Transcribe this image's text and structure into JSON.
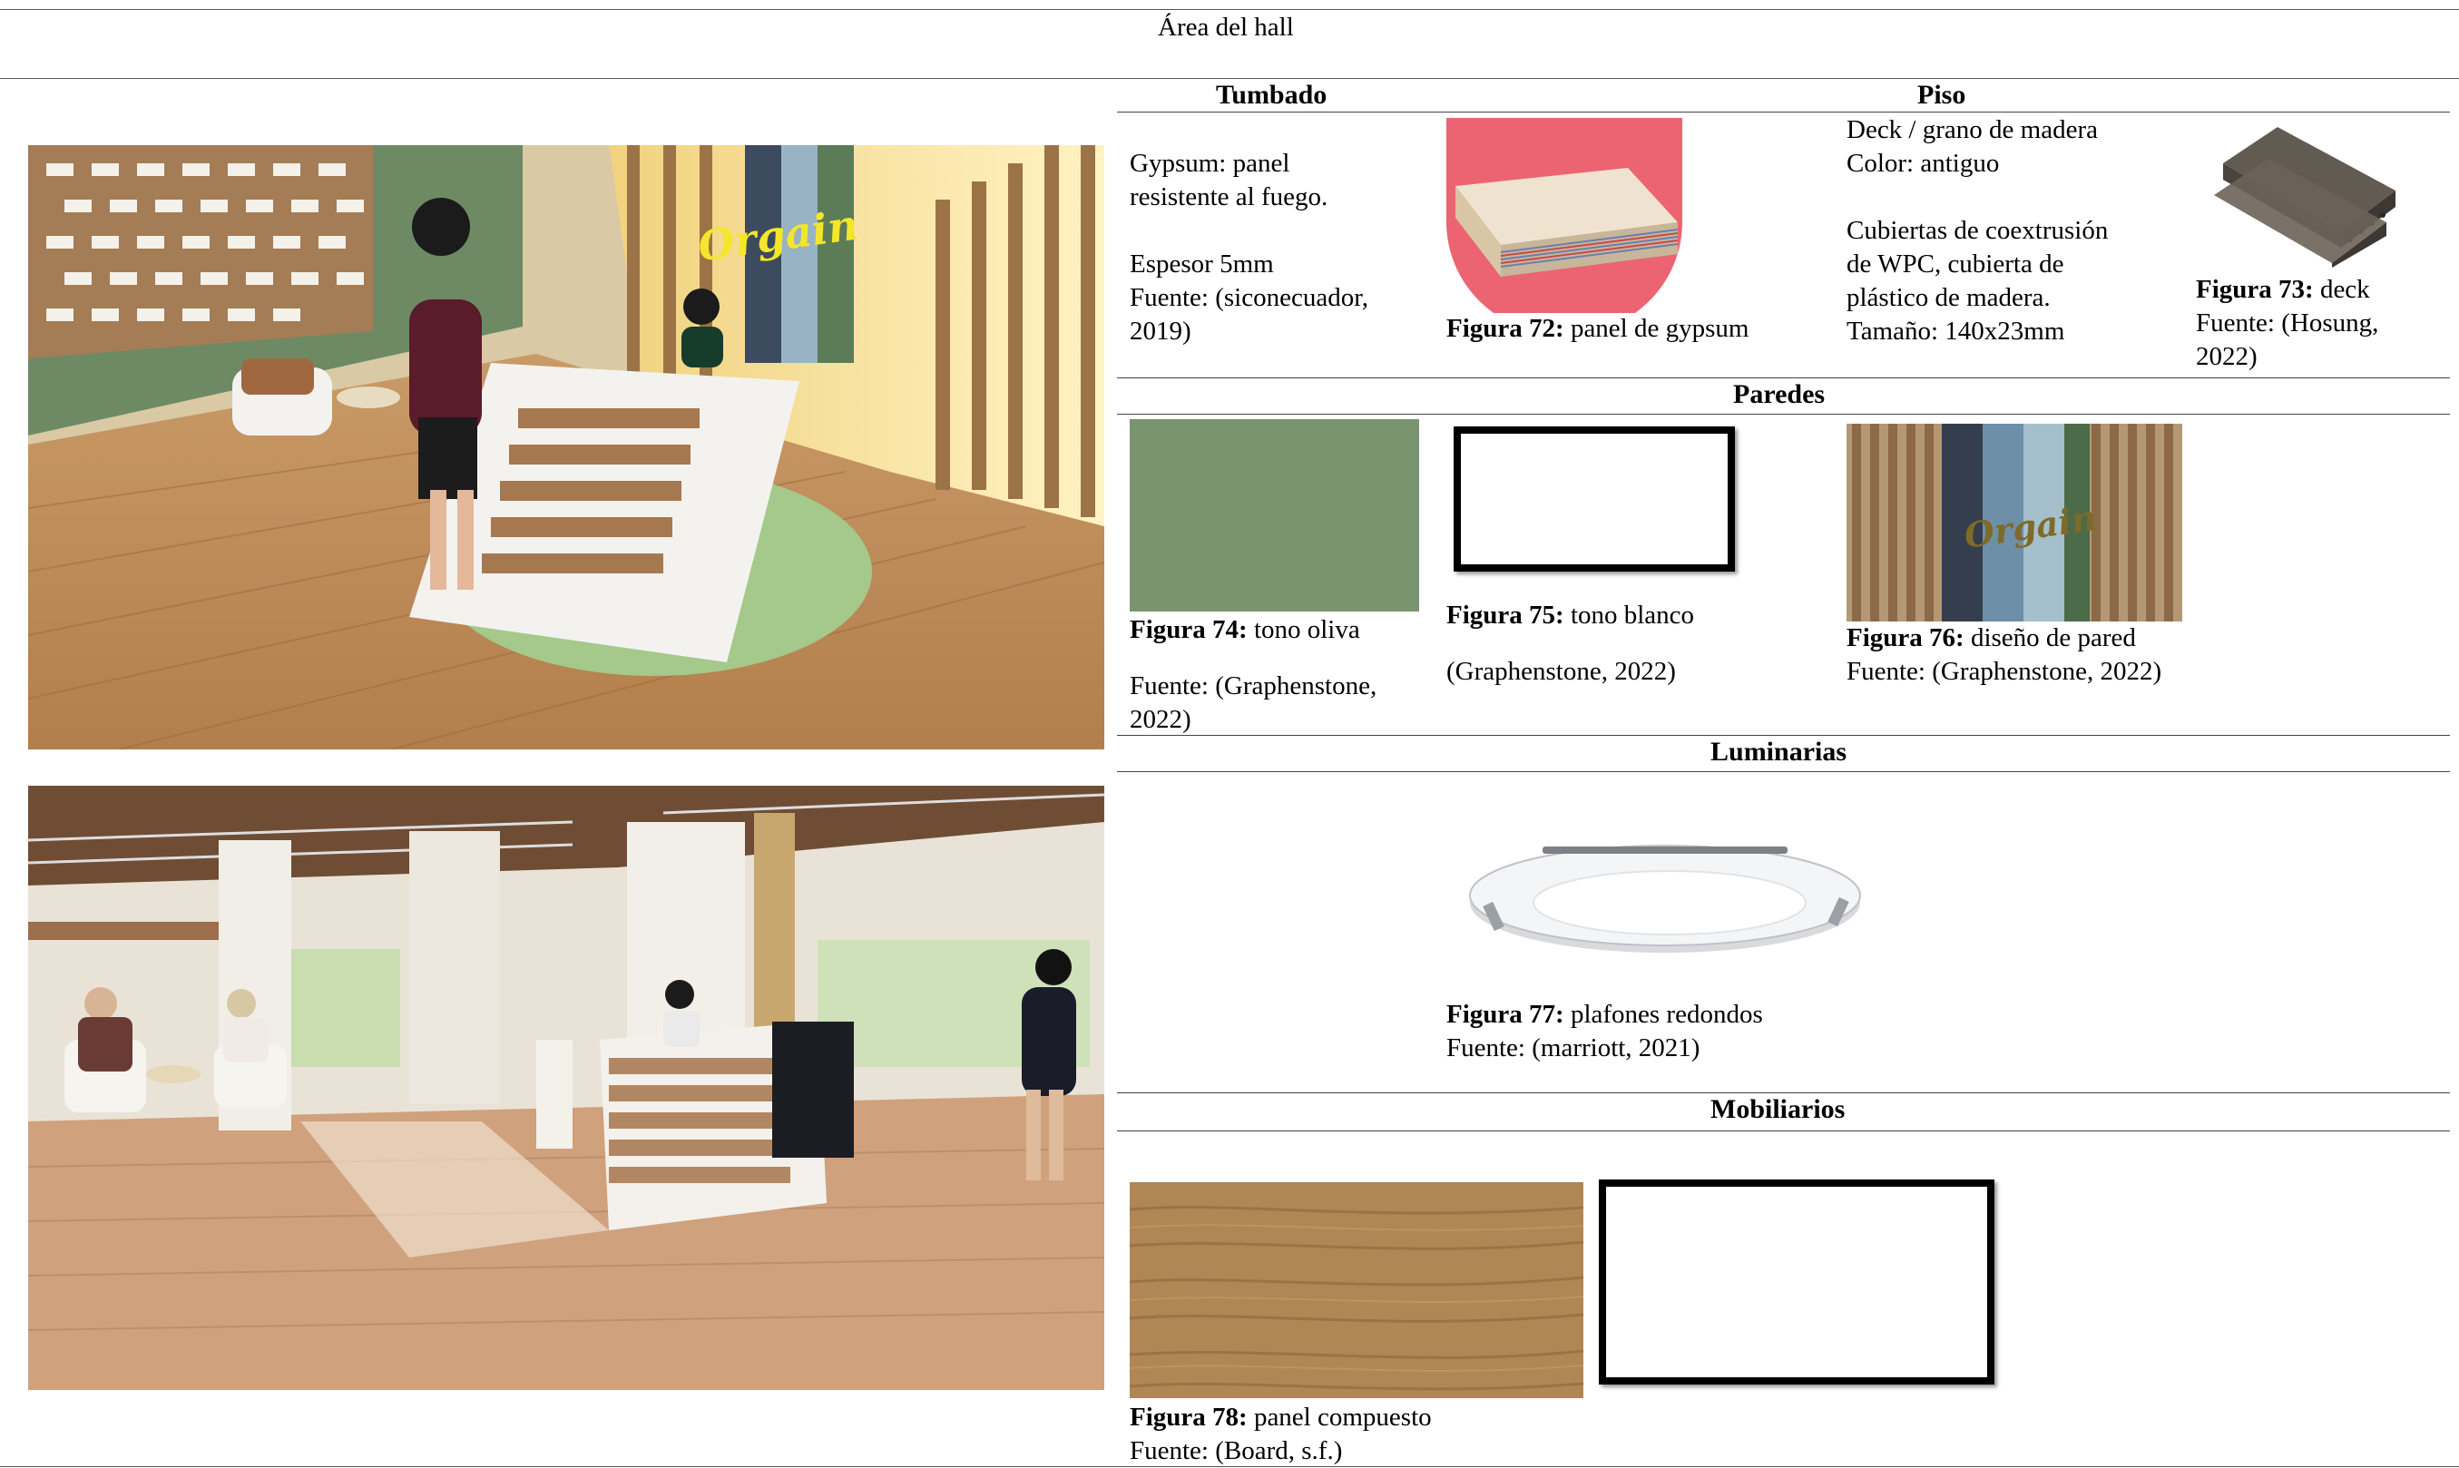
{
  "page_title": "Área del hall",
  "sections": {
    "tumbado": {
      "header": "Tumbado",
      "text_lines": [
        "Gypsum: panel",
        "resistente al fuego.",
        "",
        "Espesor 5mm",
        "Fuente: (siconecuador,",
        "2019)"
      ],
      "figure": {
        "label": "Figura 72:",
        "caption": "panel de gypsum"
      }
    },
    "piso": {
      "header": "Piso",
      "text_lines": [
        "Deck / grano de madera",
        "Color: antiguo",
        "",
        "Cubiertas de coextrusión",
        "de WPC, cubierta de",
        "plástico de madera.",
        "Tamaño: 140x23mm"
      ],
      "figure": {
        "label": "Figura 73:",
        "caption": "deck",
        "source_lines": [
          "Fuente: (Hosung,",
          "2022)"
        ]
      }
    },
    "paredes": {
      "header": "Paredes",
      "fig74": {
        "label": "Figura 74:",
        "caption": "tono oliva",
        "source_lines": [
          "Fuente: (Graphenstone,",
          "2022)"
        ],
        "color": "#7a946f"
      },
      "fig75": {
        "label": "Figura 75:",
        "caption": "tono blanco",
        "source": "(Graphenstone, 2022)"
      },
      "fig76": {
        "label": "Figura 76:",
        "caption": "diseño de pared",
        "source": "Fuente: (Graphenstone, 2022)",
        "sign_text": "Orgain"
      }
    },
    "luminarias": {
      "header": "Luminarias",
      "fig77": {
        "label": "Figura 77:",
        "caption": "plafones redondos",
        "source": "Fuente: (marriott, 2021)"
      }
    },
    "mobiliarios": {
      "header": "Mobiliarios",
      "fig78": {
        "label": "Figura 78:",
        "caption": "panel compuesto",
        "source": "Fuente: (Board, s.f.)"
      }
    }
  },
  "render_top": {
    "sign_text": "Orgain"
  },
  "colors": {
    "olive": "#7a946f",
    "wood": "#b08655",
    "neon": "#f4e62a",
    "gypsum_circle": "#ec6472"
  }
}
